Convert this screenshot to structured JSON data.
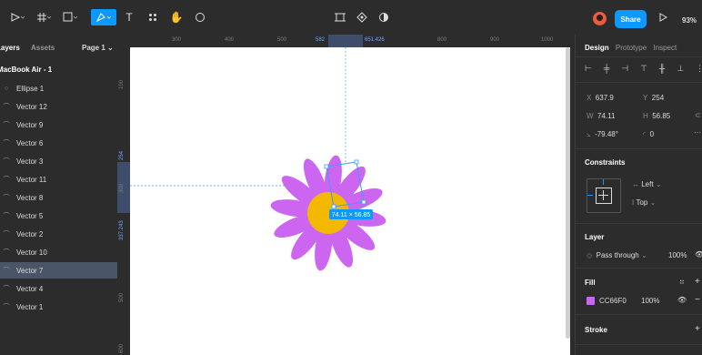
{
  "toolbar": {
    "center_tools": [
      "frame-grid-icon",
      "component-icon",
      "contrast-icon"
    ],
    "share_label": "Share",
    "zoom": "93%"
  },
  "left_panel": {
    "layers_tab": "Layers",
    "assets_tab": "Assets",
    "page_select": "Page 1",
    "frame": "MacBook Air - 1",
    "layers": [
      {
        "label": "Ellipse 1",
        "icon": "ellipse-icon",
        "selected": false
      },
      {
        "label": "Vector 12",
        "icon": "vector-icon",
        "selected": false
      },
      {
        "label": "Vector 9",
        "icon": "vector-icon",
        "selected": false
      },
      {
        "label": "Vector 6",
        "icon": "vector-icon",
        "selected": false
      },
      {
        "label": "Vector 3",
        "icon": "vector-icon",
        "selected": false
      },
      {
        "label": "Vector 11",
        "icon": "vector-icon",
        "selected": false
      },
      {
        "label": "Vector 8",
        "icon": "vector-icon",
        "selected": false
      },
      {
        "label": "Vector 5",
        "icon": "vector-icon",
        "selected": false
      },
      {
        "label": "Vector 2",
        "icon": "vector-icon",
        "selected": false
      },
      {
        "label": "Vector 10",
        "icon": "vector-icon",
        "selected": false
      },
      {
        "label": "Vector 7",
        "icon": "vector-icon",
        "selected": true
      },
      {
        "label": "Vector 4",
        "icon": "vector-icon",
        "selected": false
      },
      {
        "label": "Vector 1",
        "icon": "vector-icon",
        "selected": false
      }
    ]
  },
  "rulers": {
    "top": [
      "300",
      "400",
      "500",
      "582",
      "651.426",
      "800",
      "900",
      "1000"
    ],
    "left": [
      "100",
      "254",
      "300",
      "337.243",
      "500",
      "600"
    ]
  },
  "canvas": {
    "size_tooltip": "74.11 × 56.85",
    "flower_petal_color": "#CC66F0",
    "flower_center_color": "#F5B800"
  },
  "right_panel": {
    "tabs": [
      "Design",
      "Prototype",
      "Inspect"
    ],
    "x_label": "X",
    "x_value": "637.9",
    "y_label": "Y",
    "y_value": "254",
    "w_label": "W",
    "w_value": "74.11",
    "h_label": "H",
    "h_value": "56.85",
    "rotation": "-79.48°",
    "radius": "0",
    "constraints_title": "Constraints",
    "constraint_h": "Left",
    "constraint_v": "Top",
    "layer_title": "Layer",
    "blend_mode": "Pass through",
    "layer_opacity": "100%",
    "fill_title": "Fill",
    "fill_hex": "CC66F0",
    "fill_opacity": "100%",
    "fill_color": "#CC66F0",
    "stroke_title": "Stroke"
  }
}
